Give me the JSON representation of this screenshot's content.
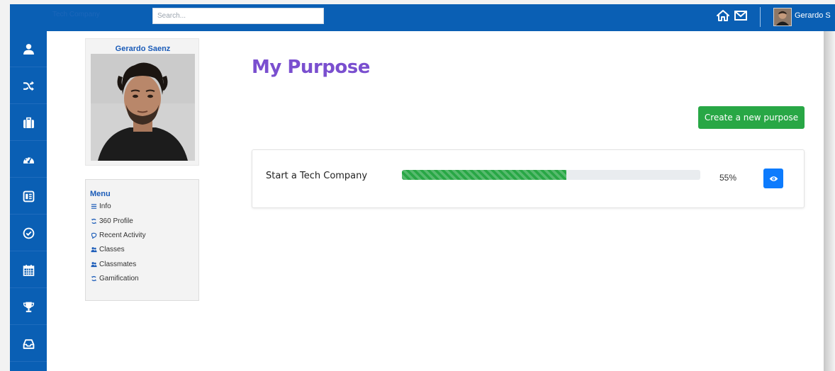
{
  "topbar": {
    "brand": "Tech Company",
    "search_placeholder": "Search...",
    "user_name": "Gerardo S",
    "icons": [
      "home-icon",
      "mail-icon"
    ]
  },
  "sidebar": {
    "icons": [
      "user-icon",
      "shuffle-icon",
      "briefcase-icon",
      "dashboard-icon",
      "list-icon",
      "check-circle-icon",
      "calendar-icon",
      "trophy-icon",
      "inbox-icon"
    ]
  },
  "profile": {
    "name": "Gerardo Saenz"
  },
  "menu": {
    "title": "Menu",
    "items": [
      {
        "label": "Info",
        "icon": "list-lines-icon"
      },
      {
        "label": "360 Profile",
        "icon": "cycle-icon"
      },
      {
        "label": "Recent Activity",
        "icon": "activity-icon"
      },
      {
        "label": "Classes",
        "icon": "users-icon"
      },
      {
        "label": "Classmates",
        "icon": "users-icon"
      },
      {
        "label": "Gamification",
        "icon": "cycle-icon"
      }
    ]
  },
  "main": {
    "title": "My Purpose",
    "create_button": "Create a new purpose",
    "purposes": [
      {
        "name": "Start a Tech Company",
        "progress": 55,
        "progress_label": "55%"
      }
    ]
  },
  "colors": {
    "primary_blue": "#0a5fb4",
    "title_purple": "#7a4fcf",
    "success_green": "#28a745",
    "view_blue": "#0d7bfd"
  }
}
